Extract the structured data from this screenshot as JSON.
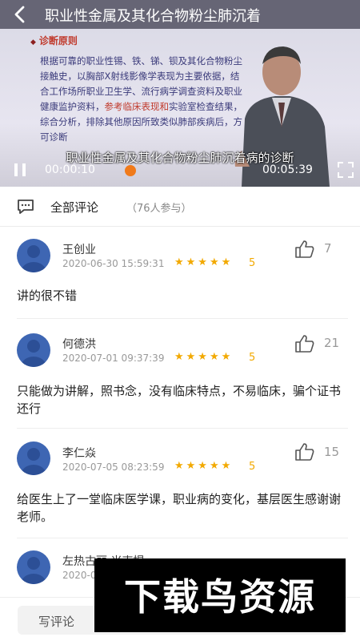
{
  "video": {
    "title": "职业性金属及其化合物粉尘肺沉着",
    "slide_heading": "诊断原则",
    "slide_body_1": "根据可靠的职业性锡、铁、锑、钡及其化合物粉尘接触史，以胸部X射线影像学表现为主要依据，结合工作场所职业卫生学、流行病学调查资料及职业健康监护资料，",
    "slide_body_link": "参考临床表现和",
    "slide_body_2": "实验室检查结果，综合分析，排除其他原因所致类似肺部疾病后，方可诊断",
    "subtitle": "职业性金属及其化合物粉尘肺沉着病的诊断",
    "current_time": "00:00:10",
    "total_time": "00:05:39",
    "progress": 0.03
  },
  "comments_header": {
    "label": "全部评论",
    "participants": "（76人参与）"
  },
  "comments": [
    {
      "name": "王创业",
      "time": "2020-06-30 15:59:31",
      "stars": "★★★★★",
      "score": "5",
      "likes": "7",
      "text": "讲的很不错"
    },
    {
      "name": "何德洪",
      "time": "2020-07-01 09:37:39",
      "stars": "★★★★★",
      "score": "5",
      "likes": "21",
      "text": "只能做为讲解，照书念，没有临床特点，不易临床，骗个证书还行"
    },
    {
      "name": "李仁焱",
      "time": "2020-07-05 08:23:59",
      "stars": "★★★★★",
      "score": "5",
      "likes": "15",
      "text": "给医生上了一堂临床医学课，职业病的变化，基层医生感谢谢老师。"
    },
    {
      "name": "左热古丽·米克提",
      "time": "2020-0",
      "stars": "",
      "score": "",
      "likes": "",
      "text": ""
    }
  ],
  "bottom": {
    "write_comment": "写评论"
  },
  "watermark": {
    "text": "下载鸟资源"
  },
  "colors": {
    "star": "#f2a900",
    "seek_knob": "#f07a1a",
    "avatar": "#3e66b3"
  }
}
